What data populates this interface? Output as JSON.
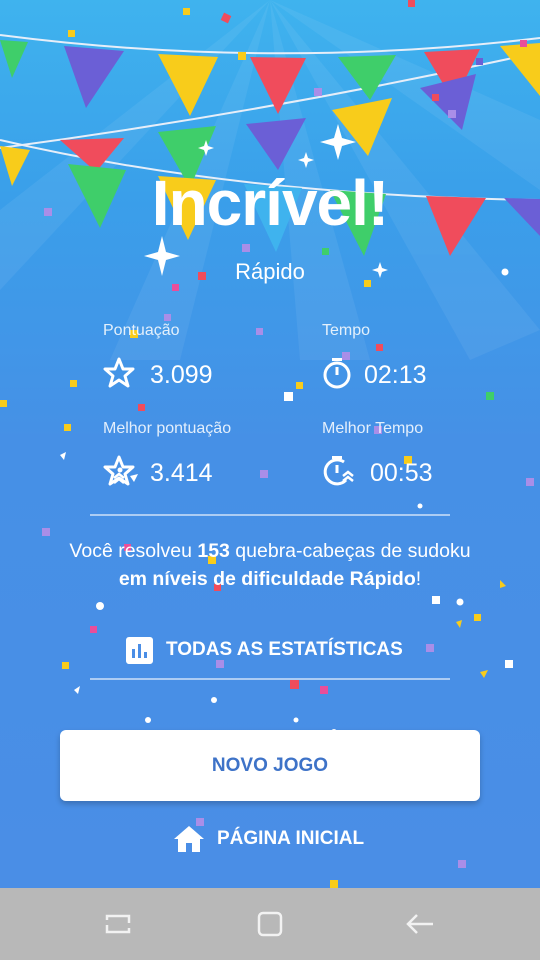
{
  "header": {
    "title": "Incrível!",
    "subtitle": "Rápido"
  },
  "stats": {
    "score": {
      "label": "Pontuação",
      "value": "3.099"
    },
    "time": {
      "label": "Tempo",
      "value": "02:13"
    },
    "best_score": {
      "label": "Melhor pontuação",
      "value": "3.414"
    },
    "best_time": {
      "label": "Melhor Tempo",
      "value": "00:53"
    }
  },
  "message": {
    "part1": "Você resolveu ",
    "count": "153",
    "part2": " quebra-cabeças de sudoku ",
    "part3": "em níveis de dificuldade Rápido",
    "part4": "!"
  },
  "actions": {
    "all_stats": "TODAS AS ESTATÍSTICAS",
    "new_game": "NOVO JOGO",
    "home": "PÁGINA INICIAL"
  },
  "icons": {
    "score": "star-icon",
    "time": "stopwatch-icon",
    "best_score": "star-rank-icon",
    "best_time": "stopwatch-rank-icon",
    "all_stats": "bar-chart-icon",
    "home": "home-icon",
    "nav_recent": "recent-apps-icon",
    "nav_home": "nav-home-icon",
    "nav_back": "back-icon"
  },
  "colors": {
    "background": "#4a8fe6",
    "background_top": "#3fb3ee",
    "button_text": "#3e73c8",
    "flag_yellow": "#f8cc1b",
    "flag_purple": "#6b5fd6",
    "flag_red": "#f04c5c",
    "flag_green": "#3fce6a",
    "nav_bar": "#b8b8b8"
  }
}
